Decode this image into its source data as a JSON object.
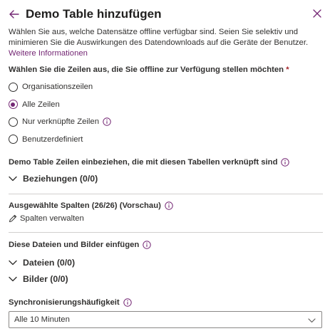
{
  "header": {
    "title": "Demo Table hinzufügen"
  },
  "description": {
    "text": "Wählen Sie aus, welche Datensätze offline verfügbar sind. Seien Sie selektiv und minimieren Sie die Auswirkungen des Datendownloads auf die Geräte der Benutzer.",
    "link_text": "Weitere Informationen"
  },
  "rows_question": {
    "label": "Wählen Sie die Zeilen aus, die Sie offline zur Verfügung stellen möchten",
    "required_mark": "*",
    "options": [
      {
        "label": "Organisationszeilen",
        "checked": false
      },
      {
        "label": "Alle Zeilen",
        "checked": true
      },
      {
        "label": "Nur verknüpfte Zeilen",
        "checked": false
      },
      {
        "label": "Benutzerdefiniert",
        "checked": false
      }
    ]
  },
  "related": {
    "label": "Demo Table Zeilen einbeziehen, die mit diesen Tabellen verknüpft sind",
    "expander": "Beziehungen (0/0)"
  },
  "columns": {
    "label": "Ausgewählte Spalten (26/26) (Vorschau)",
    "manage_link": "Spalten verwalten"
  },
  "files": {
    "label": "Diese Dateien und Bilder einfügen",
    "files_expander": "Dateien (0/0)",
    "images_expander": "Bilder (0/0)"
  },
  "sync": {
    "label": "Synchronisierungshäufigkeit",
    "value": "Alle 10 Minuten"
  },
  "colors": {
    "accent": "#742774",
    "text": "#323130",
    "divider": "#d2d0ce"
  }
}
